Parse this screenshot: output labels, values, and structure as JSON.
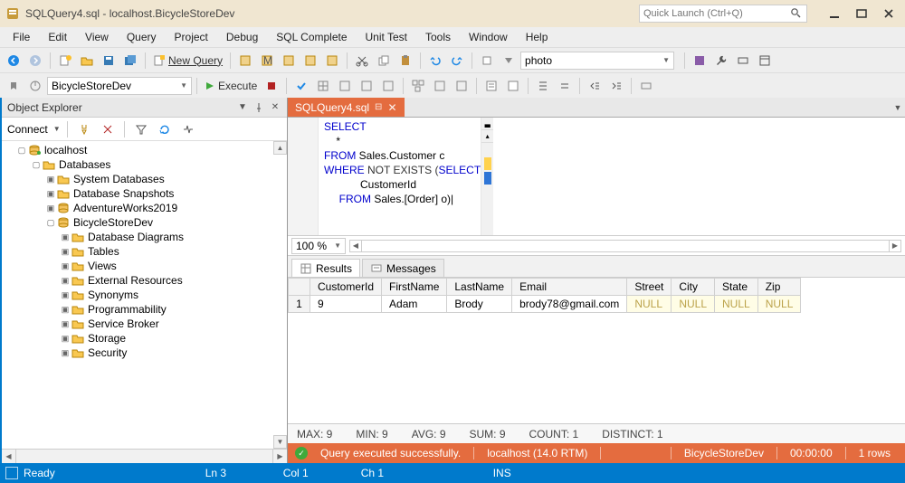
{
  "window": {
    "title": "SQLQuery4.sql - localhost.BicycleStoreDev"
  },
  "quick_launch": {
    "placeholder": "Quick Launch (Ctrl+Q)"
  },
  "menu": {
    "file": "File",
    "edit": "Edit",
    "view": "View",
    "query": "Query",
    "project": "Project",
    "debug": "Debug",
    "sql_complete": "SQL Complete",
    "unit_test": "Unit Test",
    "tools": "Tools",
    "window": "Window",
    "help": "Help"
  },
  "toolbar1": {
    "new_query": "New Query",
    "search_value": "photo"
  },
  "toolbar2": {
    "db_selected": "BicycleStoreDev",
    "execute": "Execute"
  },
  "object_explorer": {
    "title": "Object Explorer",
    "connect": "Connect",
    "nodes": {
      "server": "localhost",
      "databases": "Databases",
      "system_db": "System Databases",
      "snapshots": "Database Snapshots",
      "adv": "AdventureWorks2019",
      "bike": "BicycleStoreDev",
      "diagrams": "Database Diagrams",
      "tables": "Tables",
      "views": "Views",
      "ext": "External Resources",
      "syn": "Synonyms",
      "prog": "Programmability",
      "sb": "Service Broker",
      "storage": "Storage",
      "security": "Security"
    }
  },
  "editor": {
    "tab_name": "SQLQuery4.sql",
    "zoom": "100 %",
    "code": {
      "l1a": "SELECT",
      "l2": "    *",
      "l3a": "FROM",
      "l3b": " Sales.Customer c",
      "l4a": "WHERE",
      "l4b": " NOT EXISTS (",
      "l4c": "SELECT",
      "l5": "            CustomerId",
      "l6a": "     FROM",
      "l6b": " Sales.[Order] o)"
    }
  },
  "results": {
    "tab_results": "Results",
    "tab_messages": "Messages",
    "columns": [
      "CustomerId",
      "FirstName",
      "LastName",
      "Email",
      "Street",
      "City",
      "State",
      "Zip"
    ],
    "row_num": "1",
    "cells": {
      "CustomerId": "9",
      "FirstName": "Adam",
      "LastName": "Brody",
      "Email": "brody78@gmail.com",
      "Street": "NULL",
      "City": "NULL",
      "State": "NULL",
      "Zip": "NULL"
    }
  },
  "stats": {
    "max": "MAX:  9",
    "min": "MIN:  9",
    "avg": "AVG:  9",
    "sum": "SUM:  9",
    "count": "COUNT:  1",
    "distinct": "DISTINCT:  1"
  },
  "exec": {
    "msg": "Query executed successfully.",
    "server": "localhost (14.0 RTM)",
    "db": "BicycleStoreDev",
    "time": "00:00:00",
    "rows": "1 rows"
  },
  "status": {
    "ready": "Ready",
    "ln": "Ln 3",
    "col": "Col 1",
    "ch": "Ch 1",
    "ins": "INS"
  }
}
